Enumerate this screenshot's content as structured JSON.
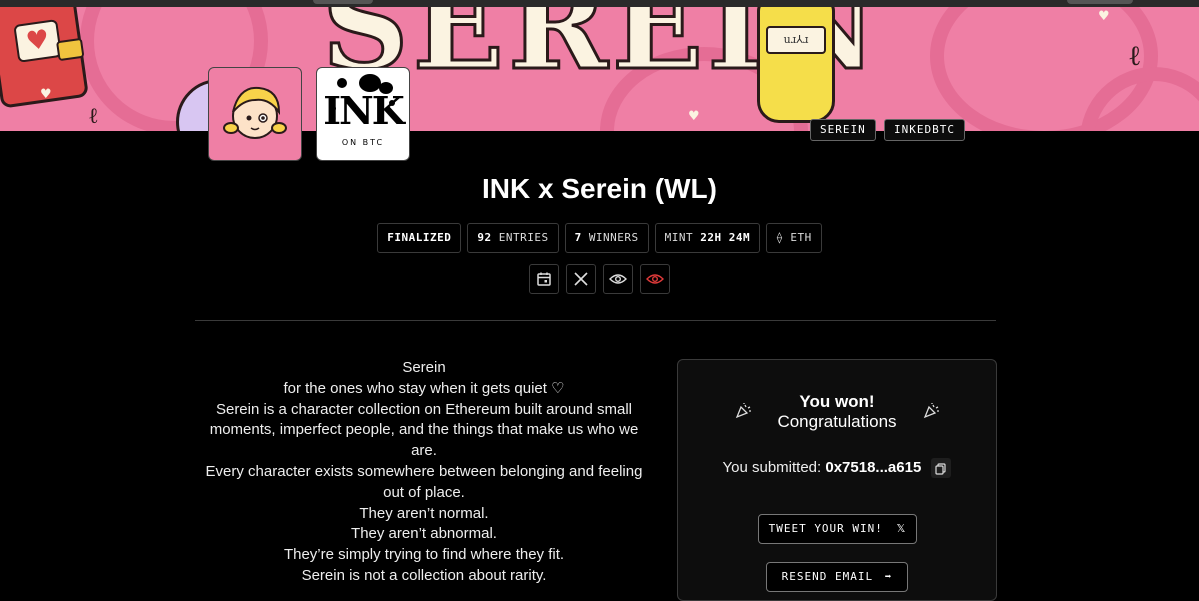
{
  "banner": {
    "title": "SEREIN",
    "jar_label": "uɹ⅄ɹ"
  },
  "tags": [
    "SEREIN",
    "INKEDBTC"
  ],
  "collab_logo": {
    "word": "INK",
    "sub": "ON BTC"
  },
  "raffle": {
    "title": "INK x Serein (WL)",
    "status": "FINALIZED",
    "entries_count": "92",
    "entries_label": "ENTRIES",
    "winners_count": "7",
    "winners_label": "WINNERS",
    "mint_label": "MINT",
    "mint_time": "22H 24M",
    "chain": "ETH"
  },
  "icons": [
    "calendar-icon",
    "x-logo-icon",
    "eye-icon",
    "eye-hidden-icon"
  ],
  "description": [
    "Serein",
    "for the ones who stay when it gets quiet ♡",
    "Serein is a character collection on Ethereum built around small moments, imperfect people, and the things that make us who we are.",
    "Every character exists somewhere between belonging and feeling out of place.",
    "They aren’t normal.",
    "They aren’t abnormal.",
    "They’re simply trying to find where they fit.",
    "Serein is not a collection about rarity."
  ],
  "result": {
    "headline": "You won!",
    "subline": "Congratulations",
    "submitted_label": "You submitted:",
    "address": "0x7518...a615",
    "tweet_button": "TWEET YOUR WIN!",
    "resend_button": "RESEND EMAIL"
  },
  "colors": {
    "banner_pink": "#ef7fa5",
    "background": "#000000",
    "card": "#0d0d0d",
    "hide_icon": "#e03a3a"
  }
}
